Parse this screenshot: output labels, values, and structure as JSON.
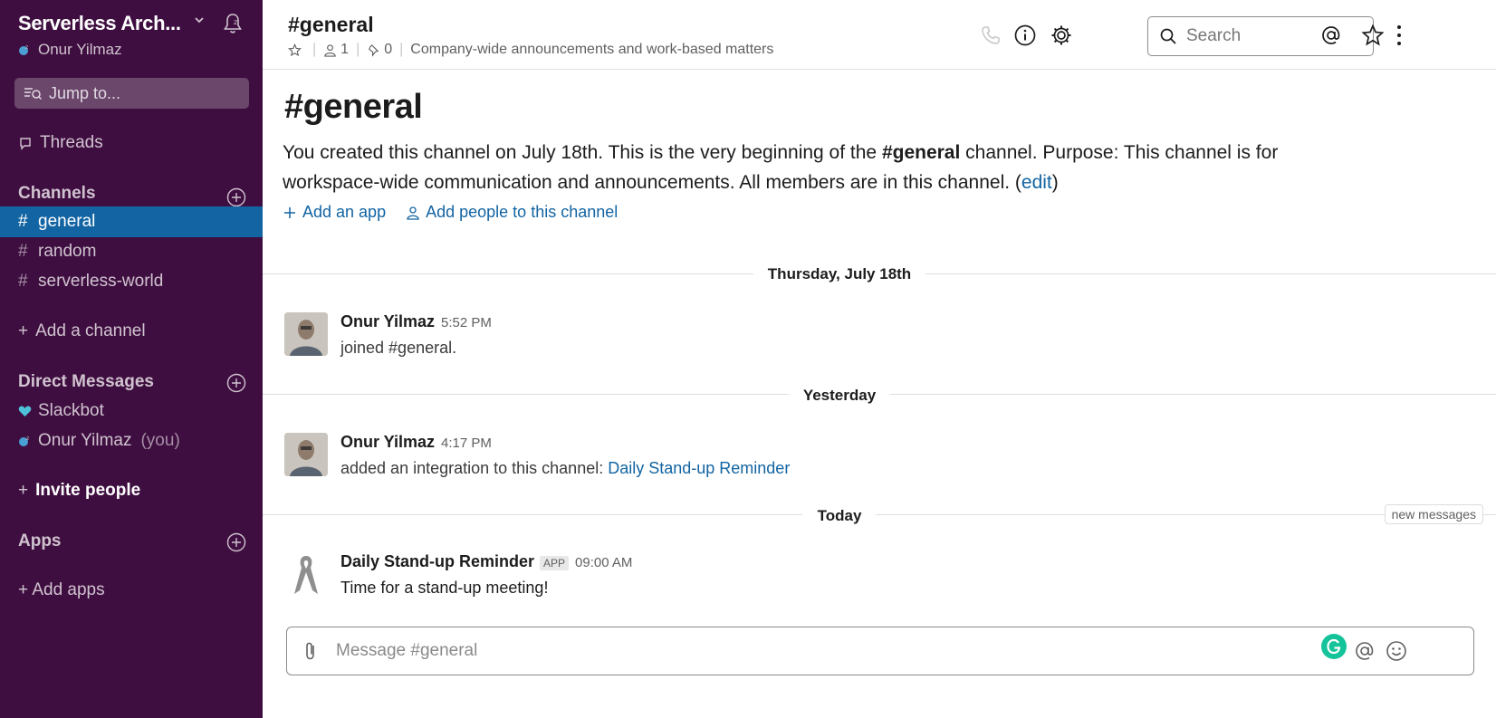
{
  "workspace": {
    "name": "Serverless Arch...",
    "user": "Onur Yilmaz"
  },
  "sidebar": {
    "jump_placeholder": "Jump to...",
    "threads_label": "Threads",
    "channels_header": "Channels",
    "channels": [
      {
        "label": "general",
        "active": true
      },
      {
        "label": "random",
        "active": false
      },
      {
        "label": "serverless-world",
        "active": false
      }
    ],
    "add_channel": "Add a channel",
    "dm_header": "Direct Messages",
    "dms": [
      {
        "label": "Slackbot",
        "suffix": ""
      },
      {
        "label": "Onur Yilmaz",
        "suffix": "(you)"
      }
    ],
    "invite_label": "Invite people",
    "apps_header": "Apps",
    "add_apps": "+ Add apps"
  },
  "header": {
    "title": "#general",
    "members": "1",
    "pins": "0",
    "topic": "Company-wide announcements and work-based matters",
    "search_placeholder": "Search"
  },
  "intro": {
    "title": "#general",
    "text_before": "You created this channel on July 18th. This is the very beginning of the ",
    "channel": "#general",
    "text_after": " channel. Purpose: This channel is for workspace-wide communication and announcements. All members are in this channel. (",
    "edit_link": "edit",
    "close_paren": ")",
    "add_app": "Add an app",
    "add_people": "Add people to this channel"
  },
  "days": [
    "Thursday, July 18th",
    "Yesterday",
    "Today"
  ],
  "new_messages_label": "new messages",
  "messages": [
    {
      "author": "Onur Yilmaz",
      "time": "5:52 PM",
      "text": "joined #general."
    },
    {
      "author": "Onur Yilmaz",
      "time": "4:17 PM",
      "text": "added an integration to this channel: ",
      "link": "Daily Stand-up Reminder"
    },
    {
      "author": "Daily Stand-up Reminder",
      "badge": "APP",
      "time": "09:00 AM",
      "text": "Time for a stand-up meeting!"
    }
  ],
  "composer": {
    "placeholder": "Message #general"
  },
  "colors": {
    "sidebar_bg": "#3f0e40",
    "active_channel": "#1264a3",
    "link": "#1264a3"
  }
}
